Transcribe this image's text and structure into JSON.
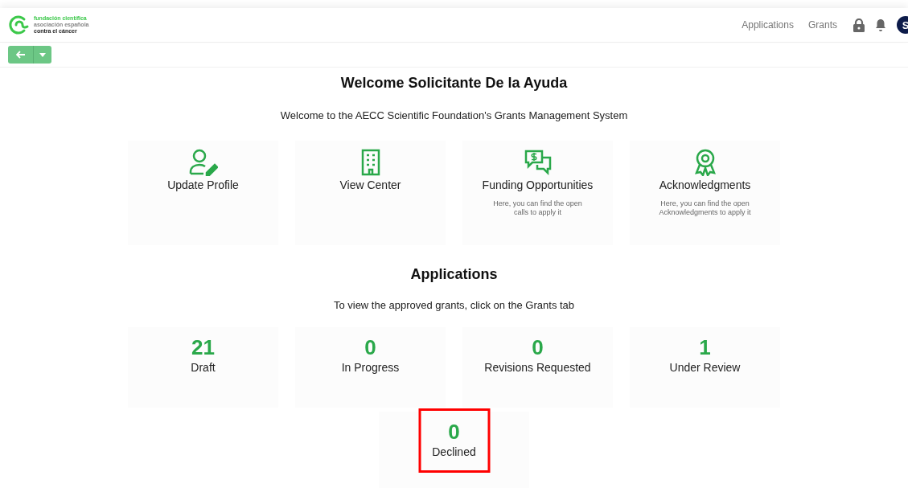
{
  "logo": {
    "line_1": "fundación científica",
    "line_2": "asociación española",
    "line_3": "contra el cáncer"
  },
  "nav": [
    {
      "label": "Applications"
    },
    {
      "label": "Grants"
    }
  ],
  "avatar": {
    "initial": "S"
  },
  "welcome": {
    "title": "Welcome Solicitante De la Ayuda",
    "subtitle": "Welcome to the AECC Scientific Foundation's Grants Management System"
  },
  "tiles": [
    {
      "kind": "profile",
      "title": "Update Profile"
    },
    {
      "kind": "building",
      "title": "View Center"
    },
    {
      "kind": "money",
      "title": "Funding Opportunities",
      "description": "Here, you can find the open calls to apply it"
    },
    {
      "kind": "award",
      "title": "Acknowledgments",
      "description": "Here, you can find the open Acknowledgments to apply it"
    }
  ],
  "applications": {
    "title": "Applications",
    "subtitle": "To view the approved grants, click on the Grants tab",
    "stats": [
      {
        "count": "21",
        "label": "Draft",
        "highlighted": false
      },
      {
        "count": "0",
        "label": "In Progress",
        "highlighted": false
      },
      {
        "count": "0",
        "label": "Revisions Requested",
        "highlighted": false
      },
      {
        "count": "1",
        "label": "Under Review",
        "highlighted": false
      },
      {
        "count": "0",
        "label": "Declined",
        "highlighted": true
      }
    ]
  }
}
